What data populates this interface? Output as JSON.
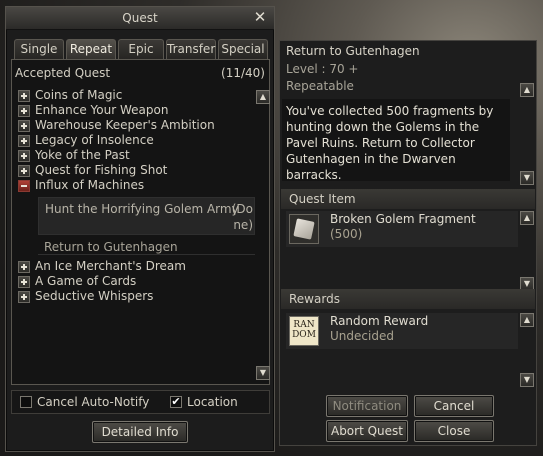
{
  "window": {
    "title": "Quest",
    "close_glyph": "✕"
  },
  "tabs": [
    {
      "label": "Single",
      "active": false
    },
    {
      "label": "Repeat",
      "active": true
    },
    {
      "label": "Epic",
      "active": false
    },
    {
      "label": "Transfer",
      "active": false
    },
    {
      "label": "Special",
      "active": false
    }
  ],
  "accepted": {
    "label": "Accepted Quest",
    "count": "(11/40)"
  },
  "quests": [
    {
      "label": "Coins of Magic",
      "state": "plus"
    },
    {
      "label": "Enhance Your Weapon",
      "state": "plus"
    },
    {
      "label": "Warehouse Keeper's Ambition",
      "state": "plus"
    },
    {
      "label": "Legacy of Insolence",
      "state": "plus"
    },
    {
      "label": "Yoke of the Past",
      "state": "plus"
    },
    {
      "label": "Quest for Fishing Shot",
      "state": "plus"
    },
    {
      "label": "Influx of Machines",
      "state": "minus"
    }
  ],
  "expanded": {
    "step1": "Hunt the Horrifying Golem Army",
    "step1_status_a": "(Do",
    "step1_status_b": "ne)",
    "step2": "Return to Gutenhagen"
  },
  "quests_after": [
    {
      "label": "An Ice Merchant's Dream",
      "state": "plus"
    },
    {
      "label": "A Game of Cards",
      "state": "plus"
    },
    {
      "label": "Seductive Whispers",
      "state": "plus"
    }
  ],
  "options": {
    "cancel_auto_notify": "Cancel Auto-Notify",
    "cancel_auto_notify_checked": false,
    "location": "Location",
    "location_checked": true,
    "check_glyph": "✔"
  },
  "buttons": {
    "detailed_info": "Detailed Info",
    "notification": "Notification",
    "cancel": "Cancel",
    "abort_quest": "Abort Quest",
    "close": "Close"
  },
  "detail": {
    "title": "Return to Gutenhagen",
    "level": "Level : 70 +",
    "repeat": "Repeatable",
    "description": "You've collected 500 fragments by hunting down the Golems in the Pavel Ruins. Return to Collector Gutenhagen in the Dwarven barracks.",
    "quest_item_header": "Quest Item",
    "item_name": "Broken Golem Fragment",
    "item_qty": "(500)",
    "rewards_header": "Rewards",
    "reward_name": "Random Reward",
    "reward_status": "Undecided",
    "reward_icon_line1": "RAN",
    "reward_icon_line2": "DOM"
  },
  "icons": {
    "scroll_up": "▲",
    "scroll_down": "▼"
  }
}
